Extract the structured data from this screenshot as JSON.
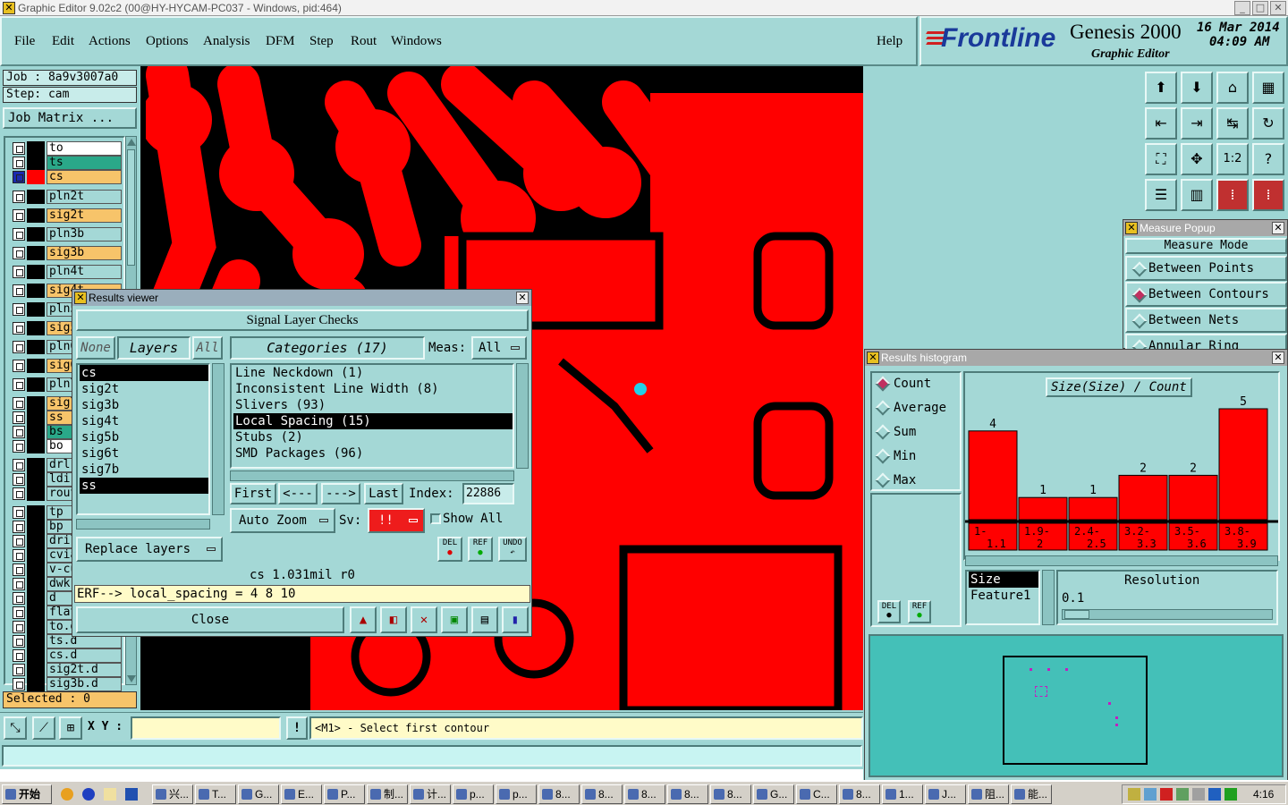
{
  "window": {
    "title": "Graphic Editor 9.02c2 (00@HY-HYCAM-PC037 - Windows, pid:464)"
  },
  "menu": [
    {
      "label": "File"
    },
    {
      "label": "Edit"
    },
    {
      "label": "Actions"
    },
    {
      "label": "Options"
    },
    {
      "label": "Analysis"
    },
    {
      "label": "DFM"
    },
    {
      "label": "Step"
    },
    {
      "label": "Rout"
    },
    {
      "label": "Windows"
    }
  ],
  "help_label": "Help",
  "logo": {
    "brand": "Frontline",
    "product": "Genesis 2000",
    "subtitle": "Graphic Editor",
    "date": "16 Mar 2014",
    "time": "04:09 AM"
  },
  "job": {
    "job_label": "Job : 8a9v3007a0",
    "step_label": "Step: cam",
    "matrix_button": "Job Matrix ..."
  },
  "layers": [
    {
      "name": "to",
      "style": "white"
    },
    {
      "name": "ts",
      "style": "green"
    },
    {
      "name": "cs",
      "style": "orange"
    },
    {
      "name": "pln2t",
      "style": "normal"
    },
    {
      "name": "sig2t",
      "style": "orange"
    },
    {
      "name": "pln3b",
      "style": "normal"
    },
    {
      "name": "sig3b",
      "style": "orange"
    },
    {
      "name": "pln4t",
      "style": "normal"
    },
    {
      "name": "sig4t",
      "style": "orange"
    },
    {
      "name": "pln5b",
      "style": "normal"
    },
    {
      "name": "sig5b",
      "style": "orange"
    },
    {
      "name": "pln6t",
      "style": "normal"
    },
    {
      "name": "sig6t",
      "style": "orange"
    },
    {
      "name": "pln7b",
      "style": "normal"
    },
    {
      "name": "sig7b",
      "style": "orange"
    },
    {
      "name": "ss",
      "style": "orange"
    },
    {
      "name": "bs",
      "style": "green"
    },
    {
      "name": "bo",
      "style": "white"
    },
    {
      "name": "drl",
      "style": "normal"
    },
    {
      "name": "ldi",
      "style": "normal"
    },
    {
      "name": "rout",
      "style": "normal"
    },
    {
      "name": "tp",
      "style": "normal"
    },
    {
      "name": "bp",
      "style": "normal"
    },
    {
      "name": "drill",
      "style": "normal"
    },
    {
      "name": "cvia",
      "style": "normal"
    },
    {
      "name": "v-cut",
      "style": "normal"
    },
    {
      "name": "dwk",
      "style": "normal"
    },
    {
      "name": "d",
      "style": "normal"
    },
    {
      "name": "flatt",
      "style": "normal"
    },
    {
      "name": "to.d",
      "style": "normal"
    },
    {
      "name": "ts.d",
      "style": "normal"
    },
    {
      "name": "cs.d",
      "style": "normal"
    },
    {
      "name": "sig2t.d",
      "style": "normal"
    },
    {
      "name": "sig3b.d",
      "style": "normal"
    }
  ],
  "selected_label": "Selected : 0",
  "status": {
    "xy_label": "X Y :",
    "xy_value": "",
    "message": "<M1> - Select first contour"
  },
  "results_viewer": {
    "title": "Results viewer",
    "heading": "Signal Layer Checks",
    "none_label": "None",
    "layers_label": "Layers",
    "all_label": "All",
    "categories_label": "Categories (17)",
    "meas_label": "Meas:",
    "meas_value": "All",
    "layer_list": [
      "cs",
      "sig2t",
      "sig3b",
      "sig4t",
      "sig5b",
      "sig6t",
      "sig7b",
      "ss"
    ],
    "category_list": [
      "Line Neckdown (1)",
      "Inconsistent Line Width (8)",
      "Slivers (93)",
      "Local Spacing (15)",
      "Stubs (2)",
      "SMD Packages (96)"
    ],
    "first_label": "First",
    "prev_label": "<---",
    "next_label": "--->",
    "last_label": "Last",
    "index_label": "Index:",
    "index_value": "22886",
    "autozoom_label": "Auto Zoom",
    "sv_label": "Sv:",
    "sv_value": "!!",
    "show_all_label": "Show All",
    "replace_label": "Replace layers",
    "del_label": "DEL",
    "ref_label": "REF",
    "undo_label": "UNDO",
    "info_line": "cs 1.031mil  r0",
    "erf_line": "ERF--> local_spacing = 4 8 10",
    "close_label": "Close"
  },
  "measure_popup": {
    "title": "Measure Popup",
    "mode_label": "Measure Mode",
    "options": [
      {
        "label": "Between Points",
        "on": false
      },
      {
        "label": "Between Contours",
        "on": true
      },
      {
        "label": "Between Nets",
        "on": false
      },
      {
        "label": "Annular Ring",
        "on": false
      }
    ]
  },
  "histogram": {
    "title": "Results histogram",
    "modes": [
      {
        "label": "Count",
        "on": true
      },
      {
        "label": "Average",
        "on": false
      },
      {
        "label": "Sum",
        "on": false
      },
      {
        "label": "Min",
        "on": false
      },
      {
        "label": "Max",
        "on": false
      }
    ],
    "chart_title": "Size(Size) / Count",
    "del_label": "DEL",
    "ref_label": "REF",
    "size_list": [
      "Size",
      "Feature1"
    ],
    "resolution_label": "Resolution",
    "resolution_value": "0.1",
    "accent_color": "#ff0000"
  },
  "chart_data": {
    "type": "bar",
    "categories": [
      "1-1.1",
      "1.9-2",
      "2.4-2.5",
      "3.2-3.3",
      "3.5-3.6",
      "3.8-3.9"
    ],
    "values": [
      4,
      1,
      1,
      2,
      2,
      5
    ],
    "title": "Size(Size) / Count",
    "xlabel": "",
    "ylabel": "",
    "ylim": [
      0,
      5
    ]
  },
  "taskbar": {
    "start_label": "开始",
    "tasks": [
      "兴...",
      "T...",
      "G...",
      "E...",
      "P...",
      "制...",
      "计...",
      "p...",
      "p...",
      "8...",
      "8...",
      "8...",
      "8...",
      "8...",
      "G...",
      "C...",
      "8...",
      "1...",
      "J...",
      "阻...",
      "能..."
    ],
    "clock": "4:16"
  }
}
